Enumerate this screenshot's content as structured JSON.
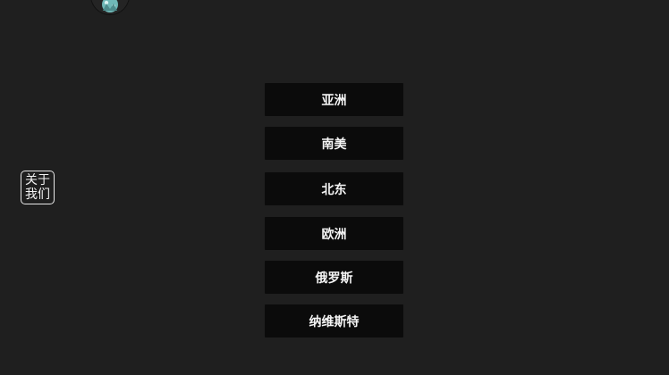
{
  "about": {
    "label": "关于我们"
  },
  "regions": [
    {
      "label": "亚洲"
    },
    {
      "label": "南美"
    },
    {
      "label": "北东"
    },
    {
      "label": "欧洲"
    },
    {
      "label": "俄罗斯"
    },
    {
      "label": "纳维斯特"
    }
  ],
  "icons": {
    "avatar": "game-avatar-icon"
  },
  "colors": {
    "background": "#1f1f1f",
    "button": "#0b0b0b",
    "text": "#f4f4f4"
  }
}
